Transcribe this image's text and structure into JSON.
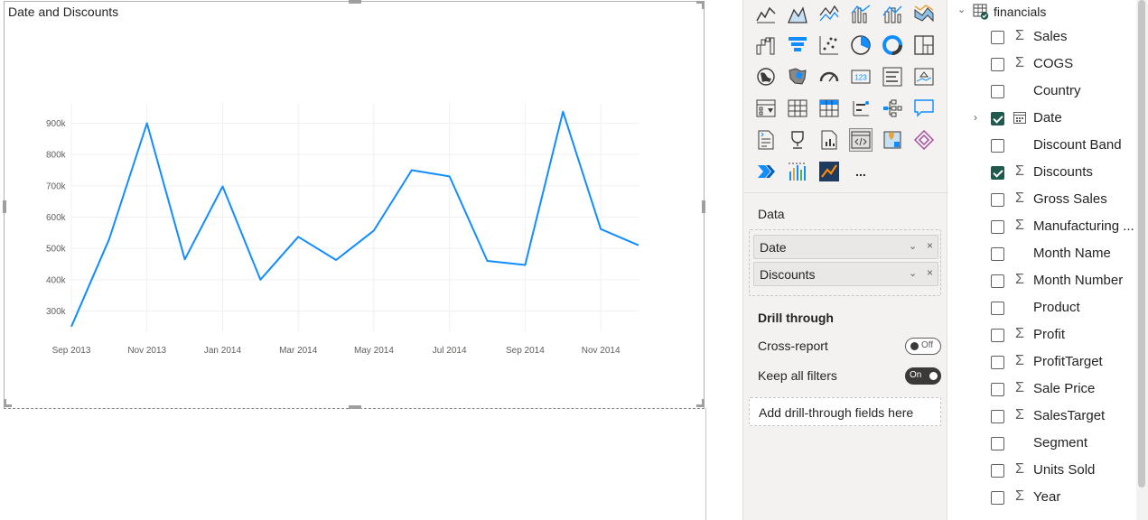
{
  "visual": {
    "title": "Date and Discounts"
  },
  "chart_data": {
    "type": "line",
    "title": "Date and Discounts",
    "xlabel": "",
    "ylabel": "",
    "x": [
      "2013-09",
      "2013-10",
      "2013-11",
      "2013-12",
      "2014-01",
      "2014-02",
      "2014-03",
      "2014-04",
      "2014-05",
      "2014-06",
      "2014-07",
      "2014-08",
      "2014-09",
      "2014-10",
      "2014-11",
      "2014-12"
    ],
    "x_tick_labels": [
      "Sep 2013",
      "Nov 2013",
      "Jan 2014",
      "Mar 2014",
      "May 2014",
      "Jul 2014",
      "Sep 2014",
      "Nov 2014"
    ],
    "y_tick_labels": [
      "300k",
      "400k",
      "500k",
      "600k",
      "700k",
      "800k",
      "900k"
    ],
    "y_ticks": [
      300000,
      400000,
      500000,
      600000,
      700000,
      800000,
      900000
    ],
    "ylim": [
      235000,
      965000
    ],
    "grid": true,
    "series": [
      {
        "values": [
          250000,
          530000,
          900000,
          465000,
          698000,
          400000,
          537000,
          463000,
          557000,
          750000,
          730000,
          460000,
          447000,
          937000,
          562000,
          510000
        ]
      }
    ],
    "colors": {
      "line": "#118dff",
      "grid": "#f0f0f0"
    }
  },
  "viz_pane": {
    "icons": [
      [
        "line-chart-icon",
        "area-chart-icon",
        "stacked-area-chart-icon",
        "line-clustered-column-icon",
        "line-stacked-column-icon",
        "ribbon-chart-icon"
      ],
      [
        "waterfall-chart-icon",
        "funnel-chart-icon",
        "scatter-chart-icon",
        "pie-chart-icon",
        "donut-chart-icon",
        "treemap-icon"
      ],
      [
        "map-icon",
        "filled-map-icon",
        "gauge-icon",
        "card-icon",
        "multi-row-card-icon",
        "kpi-icon"
      ],
      [
        "slicer-icon",
        "table-icon",
        "matrix-icon",
        "key-influencers-icon",
        "decomposition-tree-icon",
        "qa-icon"
      ],
      [
        "smart-narrative-icon",
        "metrics-icon",
        "paginated-report-icon",
        "html-content-icon",
        "azure-map-icon",
        "power-apps-icon"
      ],
      [
        "power-automate-icon",
        "custom-visual-icon",
        "custom-visual-2-icon",
        "more-visuals-icon"
      ]
    ],
    "more_label": "...",
    "data_label": "Data",
    "fields": [
      {
        "label": "Date"
      },
      {
        "label": "Discounts"
      }
    ],
    "chevron": "⌄",
    "remove": "×",
    "drill_through": {
      "title": "Drill through",
      "cross_report": {
        "label": "Cross-report",
        "state": "Off"
      },
      "keep_filters": {
        "label": "Keep all filters",
        "state": "On"
      },
      "placeholder": "Add drill-through fields here"
    }
  },
  "fields_pane": {
    "table": {
      "name": "financials",
      "chevron": "⌄"
    },
    "sigma": "Σ",
    "expander": "›",
    "fields": [
      {
        "name": "Sales",
        "sigma": true,
        "checked": false
      },
      {
        "name": "COGS",
        "sigma": true,
        "checked": false
      },
      {
        "name": "Country",
        "sigma": false,
        "checked": false
      },
      {
        "name": "Date",
        "sigma": false,
        "checked": true,
        "calendar": true,
        "expandable": true
      },
      {
        "name": "Discount Band",
        "sigma": false,
        "checked": false
      },
      {
        "name": "Discounts",
        "sigma": true,
        "checked": true
      },
      {
        "name": "Gross Sales",
        "sigma": true,
        "checked": false
      },
      {
        "name": "Manufacturing ...",
        "sigma": true,
        "checked": false
      },
      {
        "name": "Month Name",
        "sigma": false,
        "checked": false
      },
      {
        "name": "Month Number",
        "sigma": true,
        "checked": false
      },
      {
        "name": "Product",
        "sigma": false,
        "checked": false
      },
      {
        "name": "Profit",
        "sigma": true,
        "checked": false
      },
      {
        "name": "ProfitTarget",
        "sigma": true,
        "checked": false
      },
      {
        "name": "Sale Price",
        "sigma": true,
        "checked": false
      },
      {
        "name": "SalesTarget",
        "sigma": true,
        "checked": false
      },
      {
        "name": "Segment",
        "sigma": false,
        "checked": false
      },
      {
        "name": "Units Sold",
        "sigma": true,
        "checked": false
      },
      {
        "name": "Year",
        "sigma": true,
        "checked": false
      }
    ]
  }
}
